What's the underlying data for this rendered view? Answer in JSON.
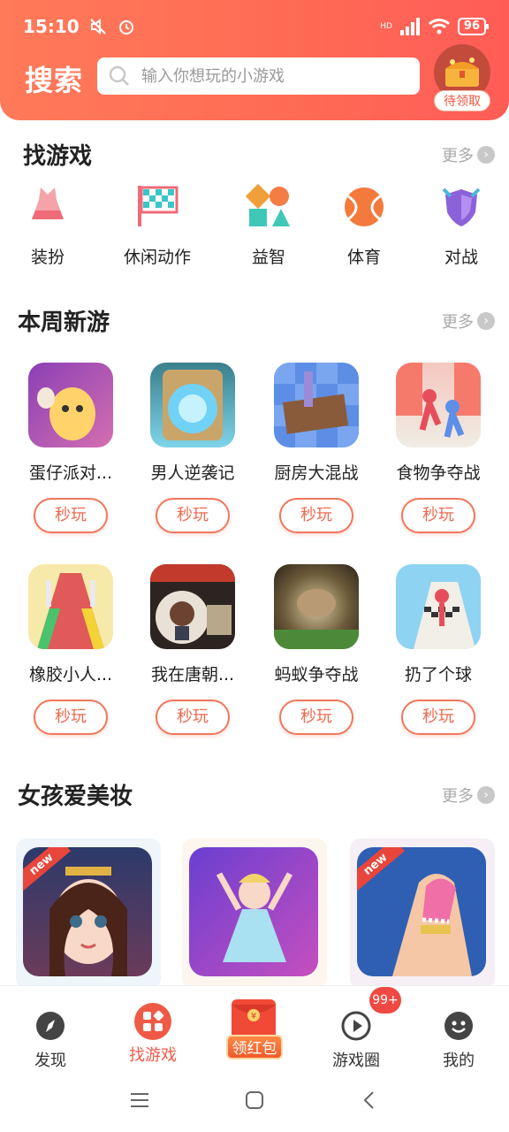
{
  "status": {
    "time": "15:10",
    "battery": "96",
    "hd": "HD"
  },
  "header": {
    "title": "搜索",
    "search_placeholder": "输入你想玩的小游戏",
    "gift_label": "待领取"
  },
  "find": {
    "title": "找游戏",
    "more": "更多",
    "categories": [
      {
        "label": "装扮",
        "icon": "dress-icon"
      },
      {
        "label": "休闲动作",
        "icon": "checkered-flag-icon"
      },
      {
        "label": "益智",
        "icon": "shapes-icon"
      },
      {
        "label": "体育",
        "icon": "ball-icon"
      },
      {
        "label": "对战",
        "icon": "shield-icon"
      }
    ]
  },
  "weekly": {
    "title": "本周新游",
    "more": "更多",
    "play_label": "秒玩",
    "games": [
      {
        "name": "蛋仔派对..."
      },
      {
        "name": "男人逆袭记"
      },
      {
        "name": "厨房大混战"
      },
      {
        "name": "食物争夺战"
      },
      {
        "name": "橡胶小人..."
      },
      {
        "name": "我在唐朝..."
      },
      {
        "name": "蚂蚁争夺战"
      },
      {
        "name": "扔了个球"
      }
    ]
  },
  "girls": {
    "title": "女孩爱美妆",
    "more": "更多",
    "new_tag": "new"
  },
  "nav": {
    "items": [
      {
        "label": "发现"
      },
      {
        "label": "找游戏"
      },
      {
        "label": "领红包"
      },
      {
        "label": "游戏圈"
      },
      {
        "label": "我的"
      }
    ],
    "badge": "99+"
  },
  "colors": {
    "accent": "#ff6a55",
    "play_border": "#f1775b"
  }
}
